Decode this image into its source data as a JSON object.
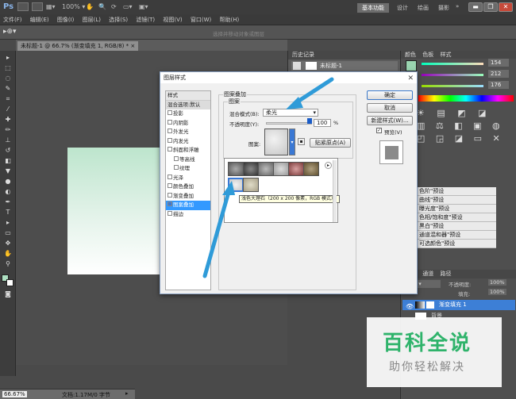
{
  "app": {
    "logo": "Ps",
    "zoom_dd": "100%",
    "workspace": {
      "active": "基本功能",
      "design": "设计",
      "paint": "绘画",
      "photo": "摄影"
    }
  },
  "menu": [
    "文件(F)",
    "编辑(E)",
    "图像(I)",
    "图层(L)",
    "选择(S)",
    "滤镜(T)",
    "视图(V)",
    "窗口(W)",
    "帮助(H)"
  ],
  "options_hint": "选择并移动对象或图层",
  "document_tab": "未标题-1 @ 66.7% (渐变填充 1, RGB/8) *",
  "status": {
    "zoom": "66.67%",
    "doc": "文档:1.17M/0 字节"
  },
  "history": {
    "tab": "历史记录",
    "item": "未标题-1"
  },
  "color_panel": {
    "tabs": [
      "颜色",
      "色板",
      "样式"
    ],
    "r": "154",
    "g": "212",
    "b": "176"
  },
  "adjustments": [
    "色阶\"预设",
    "曲线\"预设",
    "曝光度\"预设",
    "色相/饱和度\"预设",
    "黑白\"预设",
    "通道混和器\"预设",
    "可选颜色\"预设"
  ],
  "layers": {
    "tabs": [
      "图层",
      "通道",
      "路径"
    ],
    "blend": "正常",
    "opacity_label": "不透明度:",
    "opacity": "100%",
    "fill_label": "填充:",
    "fill": "100%",
    "layer1": "渐变填充 1",
    "layer2": "背景"
  },
  "dialog": {
    "title": "图层样式",
    "styles_header": "样式",
    "blend_default": "混合选项:默认",
    "styles": [
      {
        "label": "投影",
        "checked": false
      },
      {
        "label": "内阴影",
        "checked": false
      },
      {
        "label": "外发光",
        "checked": false
      },
      {
        "label": "内发光",
        "checked": false
      },
      {
        "label": "斜面和浮雕",
        "checked": false
      },
      {
        "label": "等高线",
        "checked": false,
        "indent": true
      },
      {
        "label": "纹理",
        "checked": false,
        "indent": true
      },
      {
        "label": "光泽",
        "checked": false
      },
      {
        "label": "颜色叠加",
        "checked": false
      },
      {
        "label": "渐变叠加",
        "checked": false
      },
      {
        "label": "图案叠加",
        "checked": true,
        "selected": true
      },
      {
        "label": "描边",
        "checked": false
      }
    ],
    "group_title": "图案叠加",
    "sub_group": "图案",
    "blend_label": "混合模式(B):",
    "blend_value": "柔光",
    "opacity_label": "不透明度(Y):",
    "opacity_value": "100",
    "percent": "%",
    "pattern_label": "图案:",
    "snap_button": "贴紧原点(A)",
    "ok": "确定",
    "cancel": "取消",
    "new_style": "新建样式(W)...",
    "preview": "预览(V)",
    "tooltip": "浅色大理石（200 x 200 像素，RGB 模式）"
  },
  "watermark": {
    "big": "百科全说",
    "small": "助你轻松解决"
  }
}
